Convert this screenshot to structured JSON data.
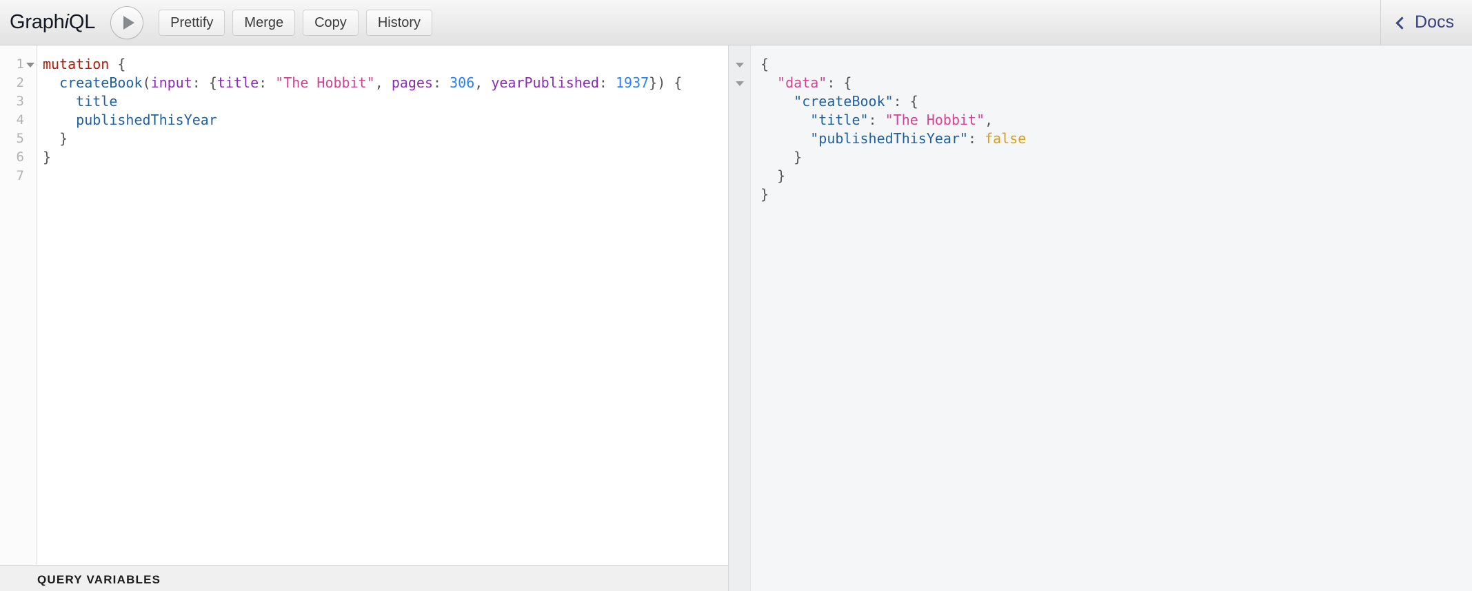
{
  "app": {
    "logo_prefix": "Graph",
    "logo_italic": "i",
    "logo_suffix": "QL"
  },
  "toolbar": {
    "execute_title": "Execute Query",
    "buttons": [
      {
        "label": "Prettify",
        "name": "prettify-button"
      },
      {
        "label": "Merge",
        "name": "merge-button"
      },
      {
        "label": "Copy",
        "name": "copy-button"
      },
      {
        "label": "History",
        "name": "history-button"
      }
    ],
    "docs_label": "Docs"
  },
  "editor": {
    "line_numbers": [
      "1",
      "2",
      "3",
      "4",
      "5",
      "6",
      "7"
    ],
    "fold_lines": [
      "1"
    ],
    "lines": [
      {
        "n": "1",
        "tokens": [
          {
            "t": "mutation",
            "c": "t-kw"
          },
          {
            "t": " {",
            "c": "t-punct"
          }
        ]
      },
      {
        "n": "2",
        "tokens": [
          {
            "t": "  ",
            "c": "t-punct"
          },
          {
            "t": "createBook",
            "c": "t-field"
          },
          {
            "t": "(",
            "c": "t-punct"
          },
          {
            "t": "input",
            "c": "t-arg"
          },
          {
            "t": ": {",
            "c": "t-punct"
          },
          {
            "t": "title",
            "c": "t-arg"
          },
          {
            "t": ": ",
            "c": "t-punct"
          },
          {
            "t": "\"The Hobbit\"",
            "c": "t-str"
          },
          {
            "t": ", ",
            "c": "t-punct"
          },
          {
            "t": "pages",
            "c": "t-arg"
          },
          {
            "t": ": ",
            "c": "t-punct"
          },
          {
            "t": "306",
            "c": "t-num"
          },
          {
            "t": ", ",
            "c": "t-punct"
          },
          {
            "t": "yearPublished",
            "c": "t-arg"
          },
          {
            "t": ": ",
            "c": "t-punct"
          },
          {
            "t": "1937",
            "c": "t-num"
          },
          {
            "t": "}) {",
            "c": "t-punct"
          }
        ]
      },
      {
        "n": "3",
        "tokens": [
          {
            "t": "    ",
            "c": "t-punct"
          },
          {
            "t": "title",
            "c": "t-field"
          }
        ]
      },
      {
        "n": "4",
        "tokens": [
          {
            "t": "    ",
            "c": "t-punct"
          },
          {
            "t": "publishedThisYear",
            "c": "t-field"
          }
        ]
      },
      {
        "n": "5",
        "tokens": [
          {
            "t": "  }",
            "c": "t-punct"
          }
        ]
      },
      {
        "n": "6",
        "tokens": [
          {
            "t": "}",
            "c": "t-punct"
          }
        ]
      },
      {
        "n": "7",
        "tokens": []
      }
    ]
  },
  "variables": {
    "title": "QUERY VARIABLES"
  },
  "result": {
    "fold_rows": [
      0,
      1
    ],
    "lines": [
      {
        "tokens": [
          {
            "t": "{",
            "c": "r-punct"
          }
        ]
      },
      {
        "tokens": [
          {
            "t": "  ",
            "c": "r-punct"
          },
          {
            "t": "\"data\"",
            "c": "r-datakey"
          },
          {
            "t": ": {",
            "c": "r-punct"
          }
        ]
      },
      {
        "tokens": [
          {
            "t": "    ",
            "c": "r-punct"
          },
          {
            "t": "\"createBook\"",
            "c": "r-key"
          },
          {
            "t": ": {",
            "c": "r-punct"
          }
        ]
      },
      {
        "tokens": [
          {
            "t": "      ",
            "c": "r-punct"
          },
          {
            "t": "\"title\"",
            "c": "r-key"
          },
          {
            "t": ": ",
            "c": "r-punct"
          },
          {
            "t": "\"The Hobbit\"",
            "c": "r-str"
          },
          {
            "t": ",",
            "c": "r-punct"
          }
        ]
      },
      {
        "tokens": [
          {
            "t": "      ",
            "c": "r-punct"
          },
          {
            "t": "\"publishedThisYear\"",
            "c": "r-key"
          },
          {
            "t": ": ",
            "c": "r-punct"
          },
          {
            "t": "false",
            "c": "r-bool"
          }
        ]
      },
      {
        "tokens": [
          {
            "t": "    }",
            "c": "r-punct"
          }
        ]
      },
      {
        "tokens": [
          {
            "t": "  }",
            "c": "r-punct"
          }
        ]
      },
      {
        "tokens": [
          {
            "t": "}",
            "c": "r-punct"
          }
        ]
      }
    ]
  },
  "colors": {
    "keyword": "#b11a04",
    "field": "#1f61a0",
    "argument": "#8b2bb9",
    "string": "#d64292",
    "number": "#2882f9",
    "boolean": "#d9a116",
    "docs_link": "#37437d",
    "result_background": "#f5f6f7"
  }
}
